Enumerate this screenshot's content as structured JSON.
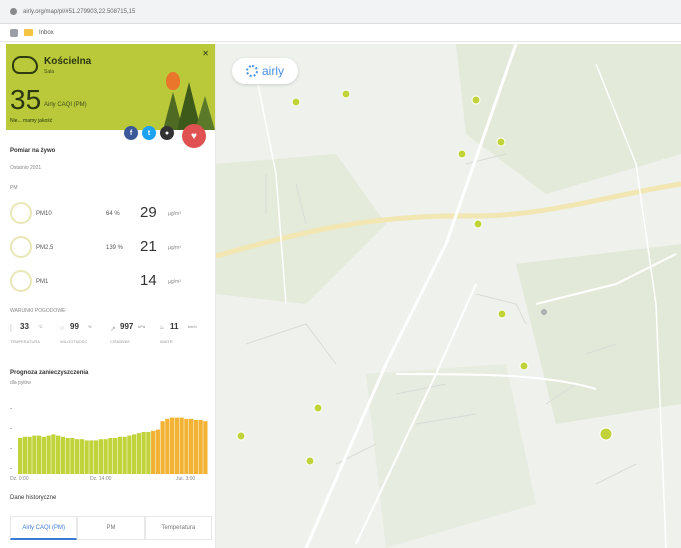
{
  "browser": {
    "url": "airly.org/map/pl/#51.279903,22.508715,15",
    "bookmark": "Inbox"
  },
  "colors": {
    "caqi_good": "#b9c93a",
    "marker": "#c1d33a",
    "chart_bar": "#c1d33a",
    "chart_bar_future": "#f2b233",
    "accent": "#3a7bd5"
  },
  "sidebar": {
    "location_name": "Kościelna",
    "location_sub": "Sala",
    "caqi_value": "35",
    "caqi_label": "Airly CAQI (PM)",
    "description": "Nie... mamy jakość",
    "live_label": "Pomiar na żywo",
    "updated": "Ostatnio 2021",
    "pm_heading": "PM",
    "pm_rows": [
      {
        "name": "PM10",
        "percent": "64 %",
        "value": "29",
        "unit": "µg/m³"
      },
      {
        "name": "PM2.5",
        "percent": "139 %",
        "value": "21",
        "unit": "µg/m³"
      },
      {
        "name": "PM1",
        "percent": "",
        "value": "14",
        "unit": "µg/m³"
      }
    ],
    "weather_heading": "WARUNKI POGODOWE",
    "weather": [
      {
        "icon": "thermometer-icon",
        "value": "33",
        "unit": "°C",
        "label": "TEMPERATURA"
      },
      {
        "icon": "humidity-icon",
        "value": "99",
        "unit": "%",
        "label": "WILGOTNOŚĆ"
      },
      {
        "icon": "pressure-icon",
        "value": "997",
        "unit": "hPa",
        "label": "CIŚNIENIE"
      },
      {
        "icon": "wind-icon",
        "value": "11",
        "unit": "km/h",
        "label": "WIATR"
      }
    ],
    "forecast_title": "Prognoza zanieczyszczenia",
    "forecast_sub": "dla pyłów",
    "data_heading": "Dane historyczne",
    "tabs": [
      "Airly CAQI (PM)",
      "PM",
      "Temperatura"
    ]
  },
  "chart_data": {
    "type": "bar",
    "title": "Prognoza zanieczyszczenia",
    "xlabel": "",
    "ylabel": "",
    "x_tick_labels": [
      "Dz. 0:00",
      "Dz. 14:00",
      "Jut. 3:00"
    ],
    "values": [
      30,
      31,
      31,
      32,
      32,
      31,
      32,
      33,
      32,
      31,
      30,
      30,
      29,
      29,
      28,
      28,
      28,
      29,
      29,
      30,
      30,
      31,
      31,
      32,
      33,
      34,
      35,
      35,
      36,
      37,
      44,
      46,
      47,
      47,
      47,
      46,
      46,
      45,
      45,
      44
    ],
    "highlight_from_index": 28,
    "ylim": [
      0,
      60
    ],
    "grid": false
  },
  "map": {
    "logo_text": "airly"
  }
}
